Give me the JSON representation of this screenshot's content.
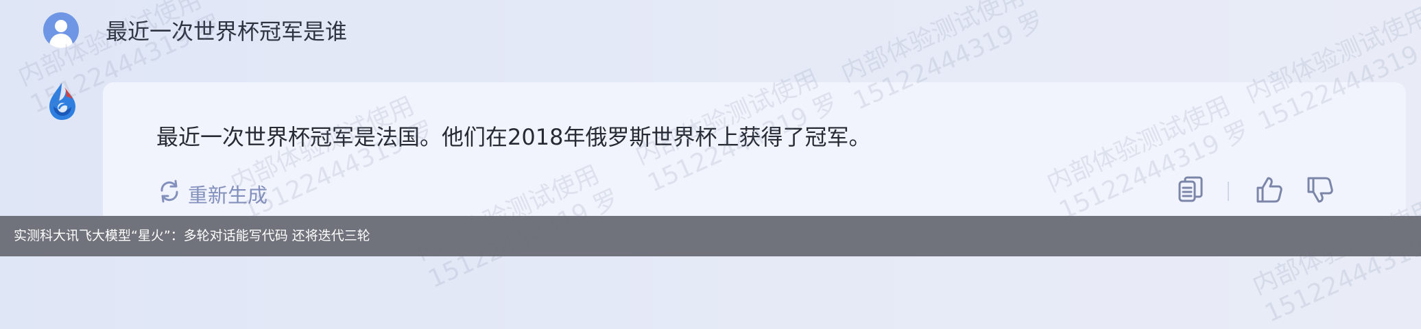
{
  "conversation": {
    "user_question": "最近一次世界杯冠军是谁",
    "bot_answer": "最近一次世界杯冠军是法国。他们在2018年俄罗斯世界杯上获得了冠军。",
    "regenerate_label": "重新生成"
  },
  "actions": {
    "copy_icon": "copy-icon",
    "like_icon": "thumbs-up-icon",
    "dislike_icon": "thumbs-down-icon"
  },
  "watermark": {
    "line1": "内部体验测试使用",
    "line2": "15122444319 罗"
  },
  "caption": "实测科大讯飞大模型“星火”：多轮对话能写代码  还将迭代三轮",
  "colors": {
    "accent": "#8390bd",
    "user_avatar": "#6f96e4",
    "caption_bg": "#696c75"
  }
}
